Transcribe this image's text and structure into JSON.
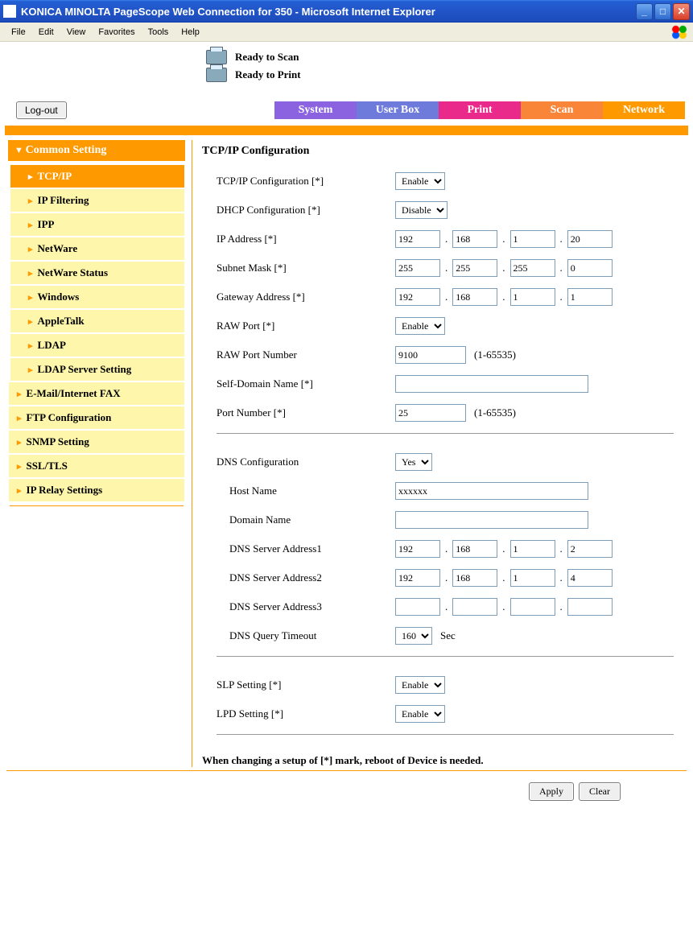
{
  "window": {
    "title": "KONICA MINOLTA PageScope Web Connection for 350 - Microsoft Internet Explorer"
  },
  "menubar": {
    "file": "File",
    "edit": "Edit",
    "view": "View",
    "favorites": "Favorites",
    "tools": "Tools",
    "help": "Help"
  },
  "status": {
    "scan": "Ready to Scan",
    "print": "Ready to Print"
  },
  "logout": "Log-out",
  "tabs": {
    "system": "System",
    "userbox": "User Box",
    "print": "Print",
    "scan": "Scan",
    "network": "Network"
  },
  "sidebar": {
    "section": "Common Setting",
    "sub": {
      "tcpip": "TCP/IP",
      "ipfiltering": "IP Filtering",
      "ipp": "IPP",
      "netware": "NetWare",
      "netwarestatus": "NetWare Status",
      "windows": "Windows",
      "appletalk": "AppleTalk",
      "ldap": "LDAP",
      "ldapserver": "LDAP Server Setting"
    },
    "items": {
      "email": "E-Mail/Internet FAX",
      "ftp": "FTP Configuration",
      "snmp": "SNMP Setting",
      "ssltls": "SSL/TLS",
      "iprelay": "IP Relay Settings"
    }
  },
  "panel": {
    "heading": "TCP/IP Configuration",
    "labels": {
      "tcpip": "TCP/IP Configuration [*]",
      "dhcp": "DHCP Configuration [*]",
      "ip": "IP Address [*]",
      "subnet": "Subnet Mask [*]",
      "gateway": "Gateway Address [*]",
      "rawport": "RAW Port [*]",
      "rawportnum": "RAW Port Number",
      "selfdomain": "Self-Domain Name [*]",
      "portnum": "Port Number [*]",
      "dnsconf": "DNS Configuration",
      "hostname": "Host Name",
      "domainname": "Domain Name",
      "dns1": "DNS Server Address1",
      "dns2": "DNS Server Address2",
      "dns3": "DNS Server Address3",
      "dnstimeout": "DNS Query Timeout",
      "slp": "SLP Setting [*]",
      "lpd": "LPD Setting [*]"
    },
    "values": {
      "tcpip": "Enable",
      "dhcp": "Disable",
      "ip": [
        "192",
        "168",
        "1",
        "20"
      ],
      "subnet": [
        "255",
        "255",
        "255",
        "0"
      ],
      "gateway": [
        "192",
        "168",
        "1",
        "1"
      ],
      "rawport": "Enable",
      "rawportnum": "9100",
      "selfdomain": "",
      "portnum": "25",
      "dnsconf": "Yes",
      "hostname": "xxxxxx",
      "domainname": "",
      "dns1": [
        "192",
        "168",
        "1",
        "2"
      ],
      "dns2": [
        "192",
        "168",
        "1",
        "4"
      ],
      "dns3": [
        "",
        "",
        "",
        ""
      ],
      "dnstimeout": "160",
      "slp": "Enable",
      "lpd": "Enable"
    },
    "hints": {
      "rawport_range": "(1-65535)",
      "port_range": "(1-65535)",
      "sec": "Sec"
    },
    "footnote": "When changing a setup of [*] mark, reboot of Device is needed."
  },
  "buttons": {
    "apply": "Apply",
    "clear": "Clear"
  }
}
